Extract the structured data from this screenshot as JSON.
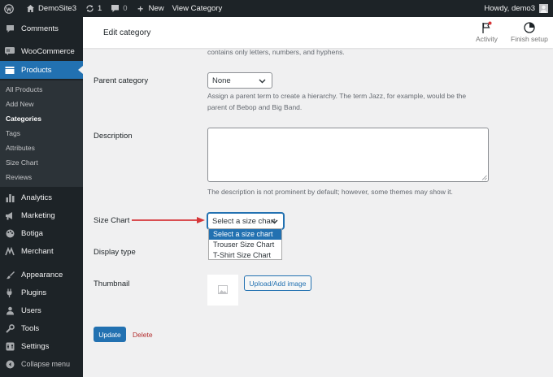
{
  "adminbar": {
    "site_name": "DemoSite3",
    "updates_count": "1",
    "comments_count": "0",
    "new_label": "New",
    "view_label": "View Category",
    "howdy": "Howdy, demo3"
  },
  "sidebar": {
    "items": [
      {
        "label": "Comments",
        "icon": "comment-icon"
      },
      {
        "label": "WooCommerce",
        "icon": "woo-icon"
      },
      {
        "label": "Products",
        "icon": "products-icon"
      },
      {
        "label": "Analytics",
        "icon": "analytics-icon"
      },
      {
        "label": "Marketing",
        "icon": "megaphone-icon"
      },
      {
        "label": "Botiga",
        "icon": "palette-icon"
      },
      {
        "label": "Merchant",
        "icon": "merchant-icon"
      },
      {
        "label": "Appearance",
        "icon": "brush-icon"
      },
      {
        "label": "Plugins",
        "icon": "plug-icon"
      },
      {
        "label": "Users",
        "icon": "user-icon"
      },
      {
        "label": "Tools",
        "icon": "wrench-icon"
      },
      {
        "label": "Settings",
        "icon": "settings-icon"
      },
      {
        "label": "Collapse menu",
        "icon": "collapse-icon"
      }
    ],
    "submenu": [
      "All Products",
      "Add New",
      "Categories",
      "Tags",
      "Attributes",
      "Size Chart",
      "Reviews"
    ]
  },
  "header": {
    "title": "Edit category",
    "activity_label": "Activity",
    "finish_label": "Finish setup"
  },
  "form": {
    "slug_help_tail": "contains only letters, numbers, and hyphens.",
    "parent_label": "Parent category",
    "parent_value": "None",
    "parent_help_1": "Assign a parent term to create a hierarchy. The term Jazz, for example, would be the",
    "parent_help_2": "parent of Bebop and Big Band.",
    "description_label": "Description",
    "description_value": "",
    "description_help": "The description is not prominent by default; however, some themes may show it.",
    "size_chart_label": "Size Chart",
    "size_chart_value": "Select a size chart",
    "size_chart_options": [
      "Select a size chart",
      "Trouser Size Chart",
      "T-Shirt Size Chart"
    ],
    "display_type_label": "Display type",
    "thumbnail_label": "Thumbnail",
    "upload_label": "Upload/Add image",
    "update_label": "Update",
    "delete_label": "Delete"
  },
  "colors": {
    "accent": "#2271b1",
    "admin_bar": "#1d2327",
    "delete": "#b32d2e",
    "arrow": "#d63638"
  }
}
